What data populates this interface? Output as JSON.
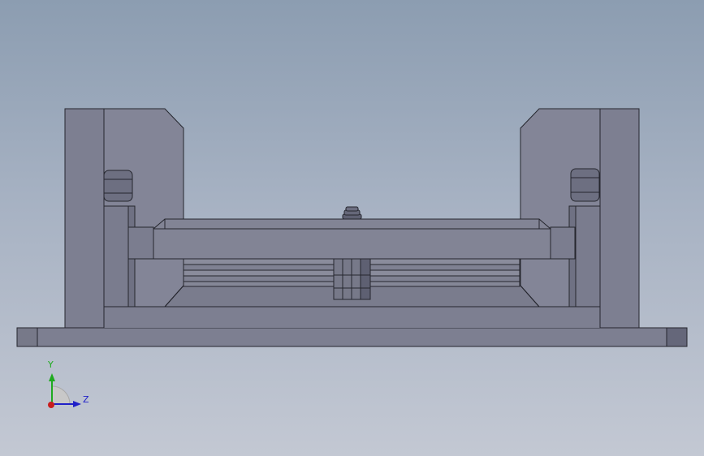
{
  "triad": {
    "y_label": "Y",
    "z_label": "Z",
    "y_color": "#1faa1f",
    "z_color": "#2020c8",
    "x_color": "#c81e1e"
  },
  "colors": {
    "part_fill": "#7d7f91",
    "part_light": "#868899",
    "part_dark": "#6a6c7e",
    "edge": "#25262e"
  }
}
